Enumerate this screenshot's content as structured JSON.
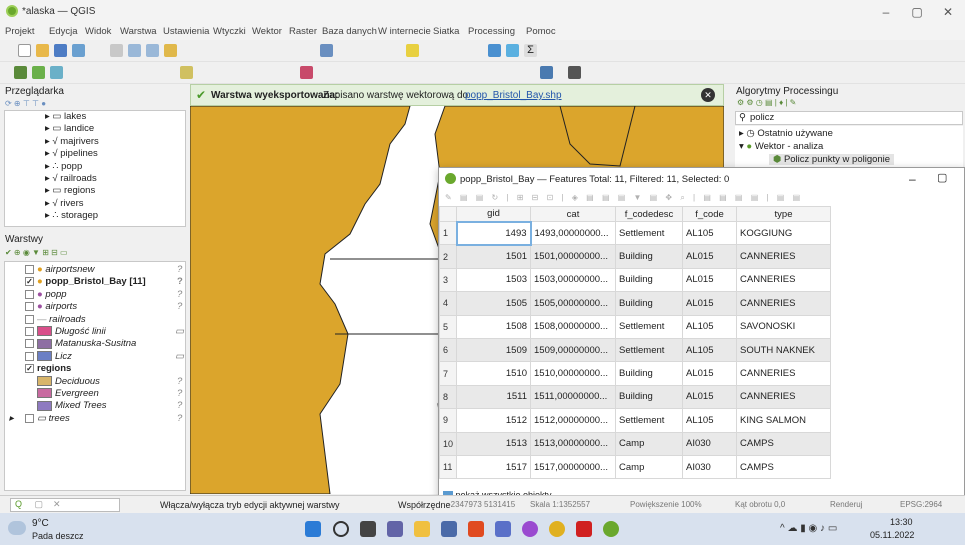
{
  "window": {
    "title": "*alaska — QGIS"
  },
  "menu": [
    "Projekt",
    "Edycja",
    "Widok",
    "Warstwa",
    "Ustawienia",
    "Wtyczki",
    "Wektor",
    "Raster",
    "Baza danych",
    "W internecie",
    "Siatka",
    "Processing",
    "Pomoc"
  ],
  "browser": {
    "title": "Przeglądarka",
    "items": [
      "lakes",
      "landice",
      "majrivers",
      "pipelines",
      "popp",
      "railroads",
      "regions",
      "rivers",
      "storagep"
    ]
  },
  "layers": {
    "title": "Warstwy",
    "items": [
      {
        "label": "airportsnew",
        "checked": false,
        "color": "#e0a020"
      },
      {
        "label": "popp_Bristol_Bay [11]",
        "checked": true,
        "color": "#e0a020"
      },
      {
        "label": "popp",
        "checked": false,
        "color": "#9c4fa0"
      },
      {
        "label": "airports",
        "checked": false,
        "color": "#9c4fa0"
      },
      {
        "label": "railroads",
        "checked": false,
        "color": "#aaaaaa"
      },
      {
        "label": "Długość linii",
        "checked": false,
        "color": "#d94f8a"
      },
      {
        "label": "Matanuska-Susitna",
        "checked": false,
        "color": "#8e6fa3"
      },
      {
        "label": "Licz",
        "checked": false,
        "color": "#6b7fc4"
      },
      {
        "label": "regions",
        "checked": true,
        "color": ""
      },
      {
        "label": "Deciduous",
        "checked": false,
        "color": "#d8b56a"
      },
      {
        "label": "Evergreen",
        "checked": false,
        "color": "#c86aa0"
      },
      {
        "label": "Mixed Trees",
        "checked": false,
        "color": "#8e7ac0"
      },
      {
        "label": "trees",
        "checked": false,
        "color": ""
      }
    ]
  },
  "message": {
    "bold": "Warstwa wyeksportowana:",
    "text": "Zapisano warstwę wektorową do",
    "link": "popp_Bristol_Bay.shp"
  },
  "processing": {
    "title": "Algorytmy Processingu",
    "search": "policz",
    "items": [
      "Ostatnio używane",
      "Wektor - analiza",
      "Policz punkty w poligonie"
    ]
  },
  "attr": {
    "title": "popp_Bristol_Bay — Features Total: 11, Filtered: 11, Selected: 0",
    "columns": [
      "gid",
      "cat",
      "f_codedesc",
      "f_code",
      "type"
    ],
    "rows": [
      [
        "1",
        "1493",
        "1493,00000000...",
        "Settlement",
        "AL105",
        "KOGGIUNG"
      ],
      [
        "2",
        "1501",
        "1501,00000000...",
        "Building",
        "AL015",
        "CANNERIES"
      ],
      [
        "3",
        "1503",
        "1503,00000000...",
        "Building",
        "AL015",
        "CANNERIES"
      ],
      [
        "4",
        "1505",
        "1505,00000000...",
        "Building",
        "AL015",
        "CANNERIES"
      ],
      [
        "5",
        "1508",
        "1508,00000000...",
        "Settlement",
        "AL105",
        "SAVONOSKI"
      ],
      [
        "6",
        "1509",
        "1509,00000000...",
        "Settlement",
        "AL105",
        "SOUTH NAKNEK"
      ],
      [
        "7",
        "1510",
        "1510,00000000...",
        "Building",
        "AL015",
        "CANNERIES"
      ],
      [
        "8",
        "1511",
        "1511,00000000...",
        "Building",
        "AL015",
        "CANNERIES"
      ],
      [
        "9",
        "1512",
        "1512,00000000...",
        "Settlement",
        "AL105",
        "KING SALMON"
      ],
      [
        "10",
        "1513",
        "1513,00000000...",
        "Camp",
        "AI030",
        "CAMPS"
      ],
      [
        "11",
        "1517",
        "1517,00000000...",
        "Camp",
        "AI030",
        "CAMPS"
      ]
    ],
    "footer": "pokaż wszystkie obiekty"
  },
  "status": {
    "toggle_text": "Włącza/wyłącza tryb edycji aktywnej warstwy",
    "coord_label": "Współrzędne",
    "coord": "-2347973 5131415",
    "scale": "Skala 1:1352557",
    "magnifier": "Powiększenie 100%",
    "rotation": "Kąt obrotu 0,0",
    "render": "Renderuj",
    "epsg": "EPSG:2964"
  },
  "taskbar": {
    "temp": "9°C",
    "weather": "Pada deszcz",
    "time": "13:30",
    "date": "05.11.2022"
  }
}
